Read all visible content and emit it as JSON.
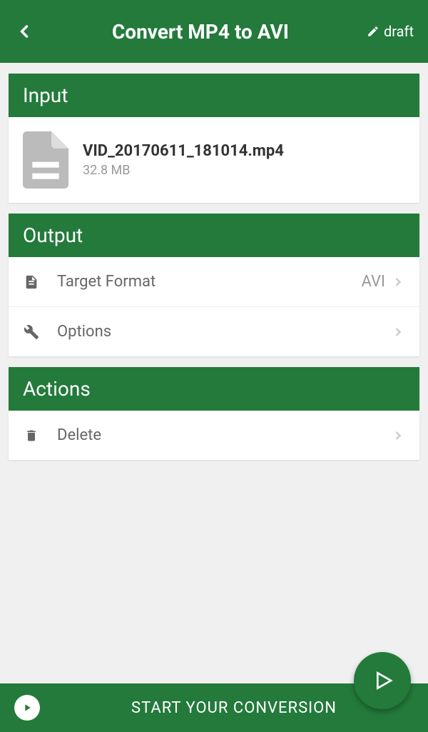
{
  "header": {
    "title": "Convert MP4 to AVI",
    "draft_label": "draft"
  },
  "sections": {
    "input": {
      "title": "Input",
      "file": {
        "name": "VID_20170611_181014.mp4",
        "size": "32.8 MB"
      }
    },
    "output": {
      "title": "Output",
      "target_format": {
        "label": "Target Format",
        "value": "AVI"
      },
      "options": {
        "label": "Options"
      }
    },
    "actions": {
      "title": "Actions",
      "delete": {
        "label": "Delete"
      }
    }
  },
  "bottom": {
    "text": "START YOUR CONVERSION"
  },
  "colors": {
    "primary": "#237a3b",
    "background": "#f0f0f0",
    "text_dark": "#333",
    "text_gray": "#666",
    "text_light": "#999"
  }
}
